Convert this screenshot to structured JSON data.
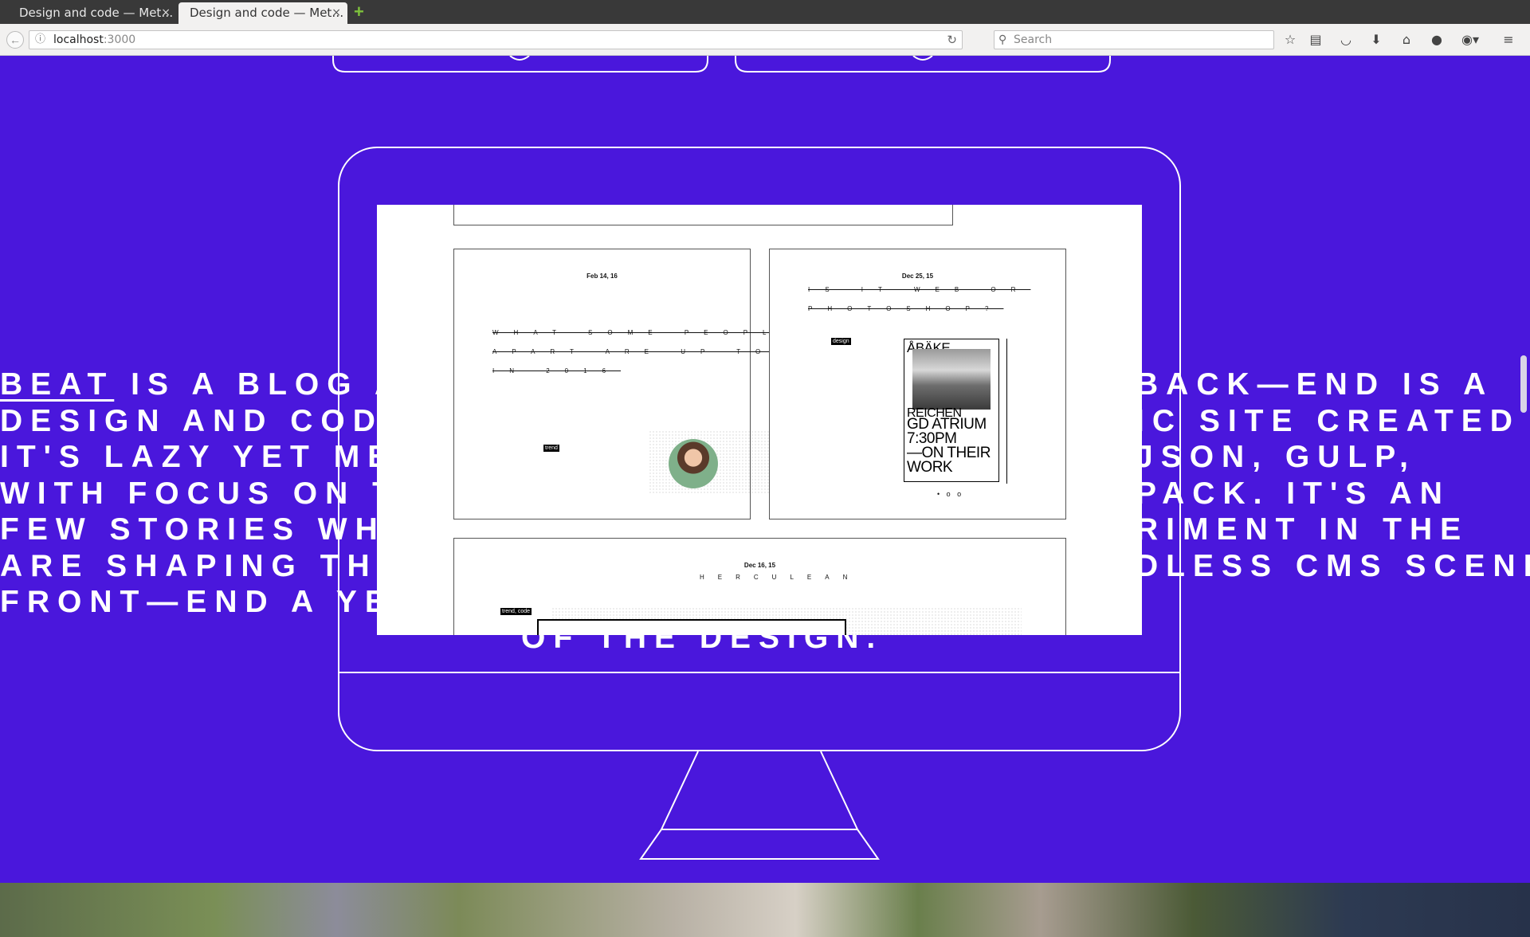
{
  "browser": {
    "tabs": [
      {
        "title": "Design and code — Met…",
        "active": false
      },
      {
        "title": "Design and code — Met…",
        "active": true
      }
    ],
    "close_glyph": "×",
    "new_tab_glyph": "+",
    "url_host": "localhost",
    "url_port": ":3000",
    "search_placeholder": "Search",
    "toolbar_icons": [
      "bookmark-star-icon",
      "reading-list-icon",
      "pocket-icon",
      "downloads-icon",
      "home-icon",
      "chat-icon",
      "adblock-icon",
      "menu-icon"
    ]
  },
  "hero": {
    "left_lines": [
      {
        "lead": "BEAT",
        "rest": " IS A BLOG AB"
      },
      {
        "lead": "",
        "rest": "DESIGN AND CODE."
      },
      {
        "lead": "",
        "rest": "IT'S LAZY YET MET"
      },
      {
        "lead": "",
        "rest": "WITH FOCUS ON TH"
      },
      {
        "lead": "",
        "rest": "FEW STORIES WHIC"
      },
      {
        "lead": "",
        "rest": "ARE SHAPING THE"
      },
      {
        "lead": "",
        "rest": "FRONT—END A YEA"
      }
    ],
    "right_lines": [
      "BACK—END IS A",
      "IC SITE CREATED",
      "JSON, GULP,",
      "PACK. IT'S AN",
      "RIMENT IN THE",
      "DLESS CMS SCENE."
    ],
    "bottom_line": "OF THE DESIGN."
  },
  "screen": {
    "cards": [
      {
        "date": "Feb 14, 16",
        "title_lines": [
          "WHAT SOME PEOPLE",
          "APART ARE UP TO",
          "IN 2016"
        ],
        "tag": "trend"
      },
      {
        "date": "Dec 25, 15",
        "title_lines": [
          "IS IT WEB OR",
          "PHOTOSHOP?"
        ],
        "tag": "design",
        "poster_lines": [
          "ÅBÄKE",
          "REICHEN",
          "GD ATRIUM",
          "7:30PM",
          "—ON THEIR",
          "WORK"
        ],
        "pager": "• o o"
      },
      {
        "date": "Dec 16, 15",
        "title_lines": [
          "HERCULEAN"
        ],
        "tag": "trend, code"
      }
    ]
  },
  "colors": {
    "background": "#4a17dc",
    "line": "#ffffff"
  }
}
